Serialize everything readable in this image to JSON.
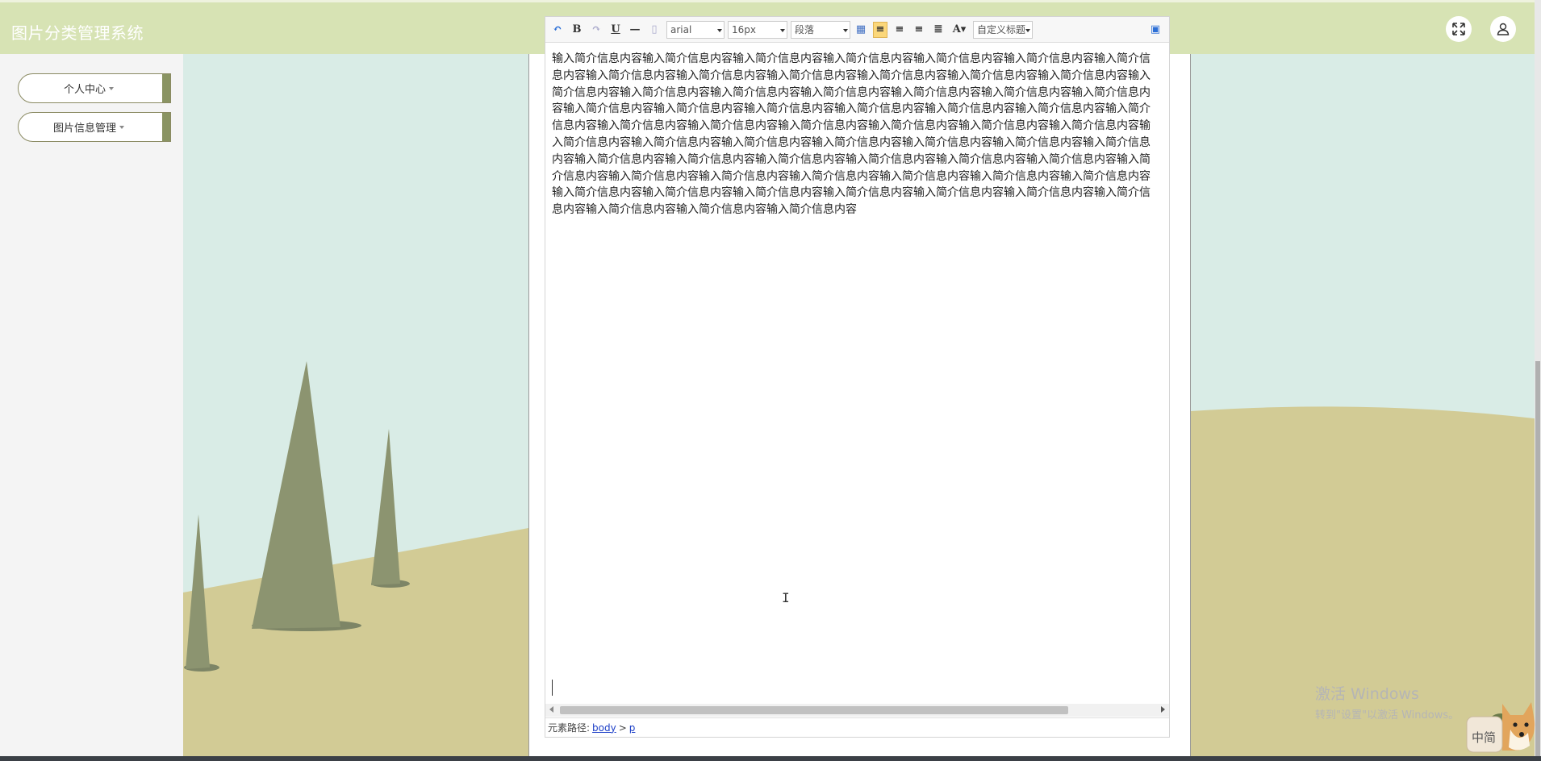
{
  "app": {
    "title": "图片分类管理系统"
  },
  "header": {
    "fullscreen_icon": "expand-icon",
    "user_icon": "user-icon"
  },
  "sidebar": {
    "items": [
      {
        "label": "个人中心"
      },
      {
        "label": "图片信息管理"
      }
    ]
  },
  "editor": {
    "toolbar": {
      "font_family": "arial",
      "font_size": "16px",
      "paragraph": "段落",
      "custom_title": "自定义标题"
    },
    "content": "输入简介信息内容输入简介信息内容输入简介信息内容输入简介信息内容输入简介信息内容输入简介信息内容输入简介信息内容输入简介信息内容输入简介信息内容输入简介信息内容输入简介信息内容输入简介信息内容输入简介信息内容输入简介信息内容输入简介信息内容输入简介信息内容输入简介信息内容输入简介信息内容输入简介信息内容输入简介信息内容输入简介信息内容输入简介信息内容输入简介信息内容输入简介信息内容输入简介信息内容输入简介信息内容输入简介信息内容输入简介信息内容输入简介信息内容输入简介信息内容输入简介信息内容输入简介信息内容输入简介信息内容输入简介信息内容输入简介信息内容输入简介信息内容输入简介信息内容输入简介信息内容输入简介信息内容输入简介信息内容输入简介信息内容输入简介信息内容输入简介信息内容输入简介信息内容输入简介信息内容输入简介信息内容输入简介信息内容输入简介信息内容输入简介信息内容输入简介信息内容输入简介信息内容输入简介信息内容输入简介信息内容输入简介信息内容输入简介信息内容输入简介信息内容输入简介信息内容输入简介信息内容输入简介信息内容输入简介信息内容输入简介信息内容输入简介信息内容输入简介信息内容",
    "status": {
      "label": "元素路径:",
      "path_body": "body",
      "path_sep": ">",
      "path_p": "p"
    }
  },
  "watermark": {
    "line1": "激活 Windows",
    "line2": "转到\"设置\"以激活 Windows。"
  },
  "ime": {
    "label": "中简"
  },
  "colors": {
    "header_bg": "#d7e3b4",
    "accent": "#8a9463",
    "hill": "#d2cb95",
    "tree": "#8c9470"
  }
}
